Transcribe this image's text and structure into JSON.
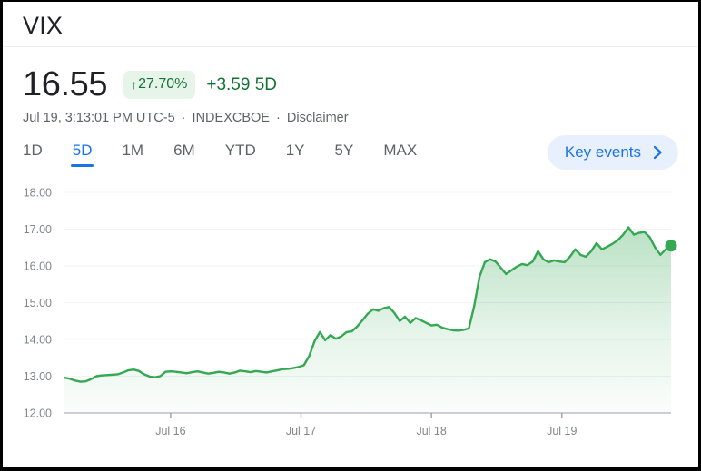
{
  "window": {
    "title": "VIX"
  },
  "quote": {
    "price": "16.55",
    "change_pct": "27.70%",
    "change_arrow": "↑",
    "change_abs": "+3.59",
    "change_period": "5D",
    "timestamp": "Jul 19, 3:13:01 PM UTC-5",
    "exchange": "INDEXCBOE",
    "disclaimer": "Disclaimer",
    "separator": "·",
    "accent_positive": "#137333",
    "badge_bg": "#e6f4ea"
  },
  "tabs": {
    "items": [
      {
        "label": "1D",
        "selected": false
      },
      {
        "label": "5D",
        "selected": true
      },
      {
        "label": "1M",
        "selected": false
      },
      {
        "label": "6M",
        "selected": false
      },
      {
        "label": "YTD",
        "selected": false
      },
      {
        "label": "1Y",
        "selected": false
      },
      {
        "label": "5Y",
        "selected": false
      },
      {
        "label": "MAX",
        "selected": false
      }
    ],
    "selected_accent": "#1a73e8"
  },
  "key_events": {
    "label": "Key events",
    "icon": "chevron-right-icon",
    "bg": "#e8f0fe",
    "fg": "#1a73e8"
  },
  "chart_data": {
    "type": "area",
    "title": "VIX",
    "xlabel": "",
    "ylabel": "",
    "ylim": [
      12.0,
      18.0
    ],
    "grid": true,
    "legend": false,
    "line_color": "#34a853",
    "fill_color": "#34a853",
    "ytick_labels": [
      "18.00",
      "17.00",
      "16.00",
      "15.00",
      "14.00",
      "13.00",
      "12.00"
    ],
    "ytick_values": [
      18.0,
      17.0,
      16.0,
      15.0,
      14.0,
      13.0,
      12.0
    ],
    "xtick_labels": [
      "Jul 16",
      "Jul 17",
      "Jul 18",
      "Jul 19"
    ],
    "xtick_positions": [
      0.175,
      0.39,
      0.605,
      0.82
    ],
    "end_marker": {
      "value": 16.55,
      "label": "16.55",
      "color": "#34a853"
    },
    "series": [
      {
        "name": "VIX",
        "values": [
          12.96,
          12.93,
          12.88,
          12.85,
          12.86,
          12.92,
          13.0,
          13.02,
          13.03,
          13.04,
          13.05,
          13.1,
          13.16,
          13.18,
          13.14,
          13.05,
          12.99,
          12.97,
          13.0,
          13.12,
          13.13,
          13.12,
          13.1,
          13.08,
          13.11,
          13.13,
          13.1,
          13.07,
          13.09,
          13.12,
          13.1,
          13.07,
          13.1,
          13.15,
          13.13,
          13.11,
          13.14,
          13.12,
          13.1,
          13.13,
          13.16,
          13.19,
          13.2,
          13.22,
          13.25,
          13.3,
          13.55,
          13.95,
          14.2,
          13.98,
          14.12,
          14.02,
          14.08,
          14.2,
          14.22,
          14.35,
          14.52,
          14.7,
          14.82,
          14.78,
          14.85,
          14.88,
          14.72,
          14.5,
          14.62,
          14.45,
          14.58,
          14.52,
          14.45,
          14.38,
          14.4,
          14.32,
          14.28,
          14.25,
          14.24,
          14.26,
          14.3,
          14.9,
          15.7,
          16.1,
          16.18,
          16.12,
          15.95,
          15.78,
          15.88,
          15.98,
          16.05,
          16.02,
          16.12,
          16.4,
          16.18,
          16.1,
          16.15,
          16.12,
          16.1,
          16.25,
          16.45,
          16.3,
          16.25,
          16.4,
          16.62,
          16.45,
          16.52,
          16.6,
          16.7,
          16.85,
          17.05,
          16.85,
          16.9,
          16.92,
          16.78,
          16.5,
          16.3,
          16.45,
          16.55
        ]
      }
    ]
  }
}
